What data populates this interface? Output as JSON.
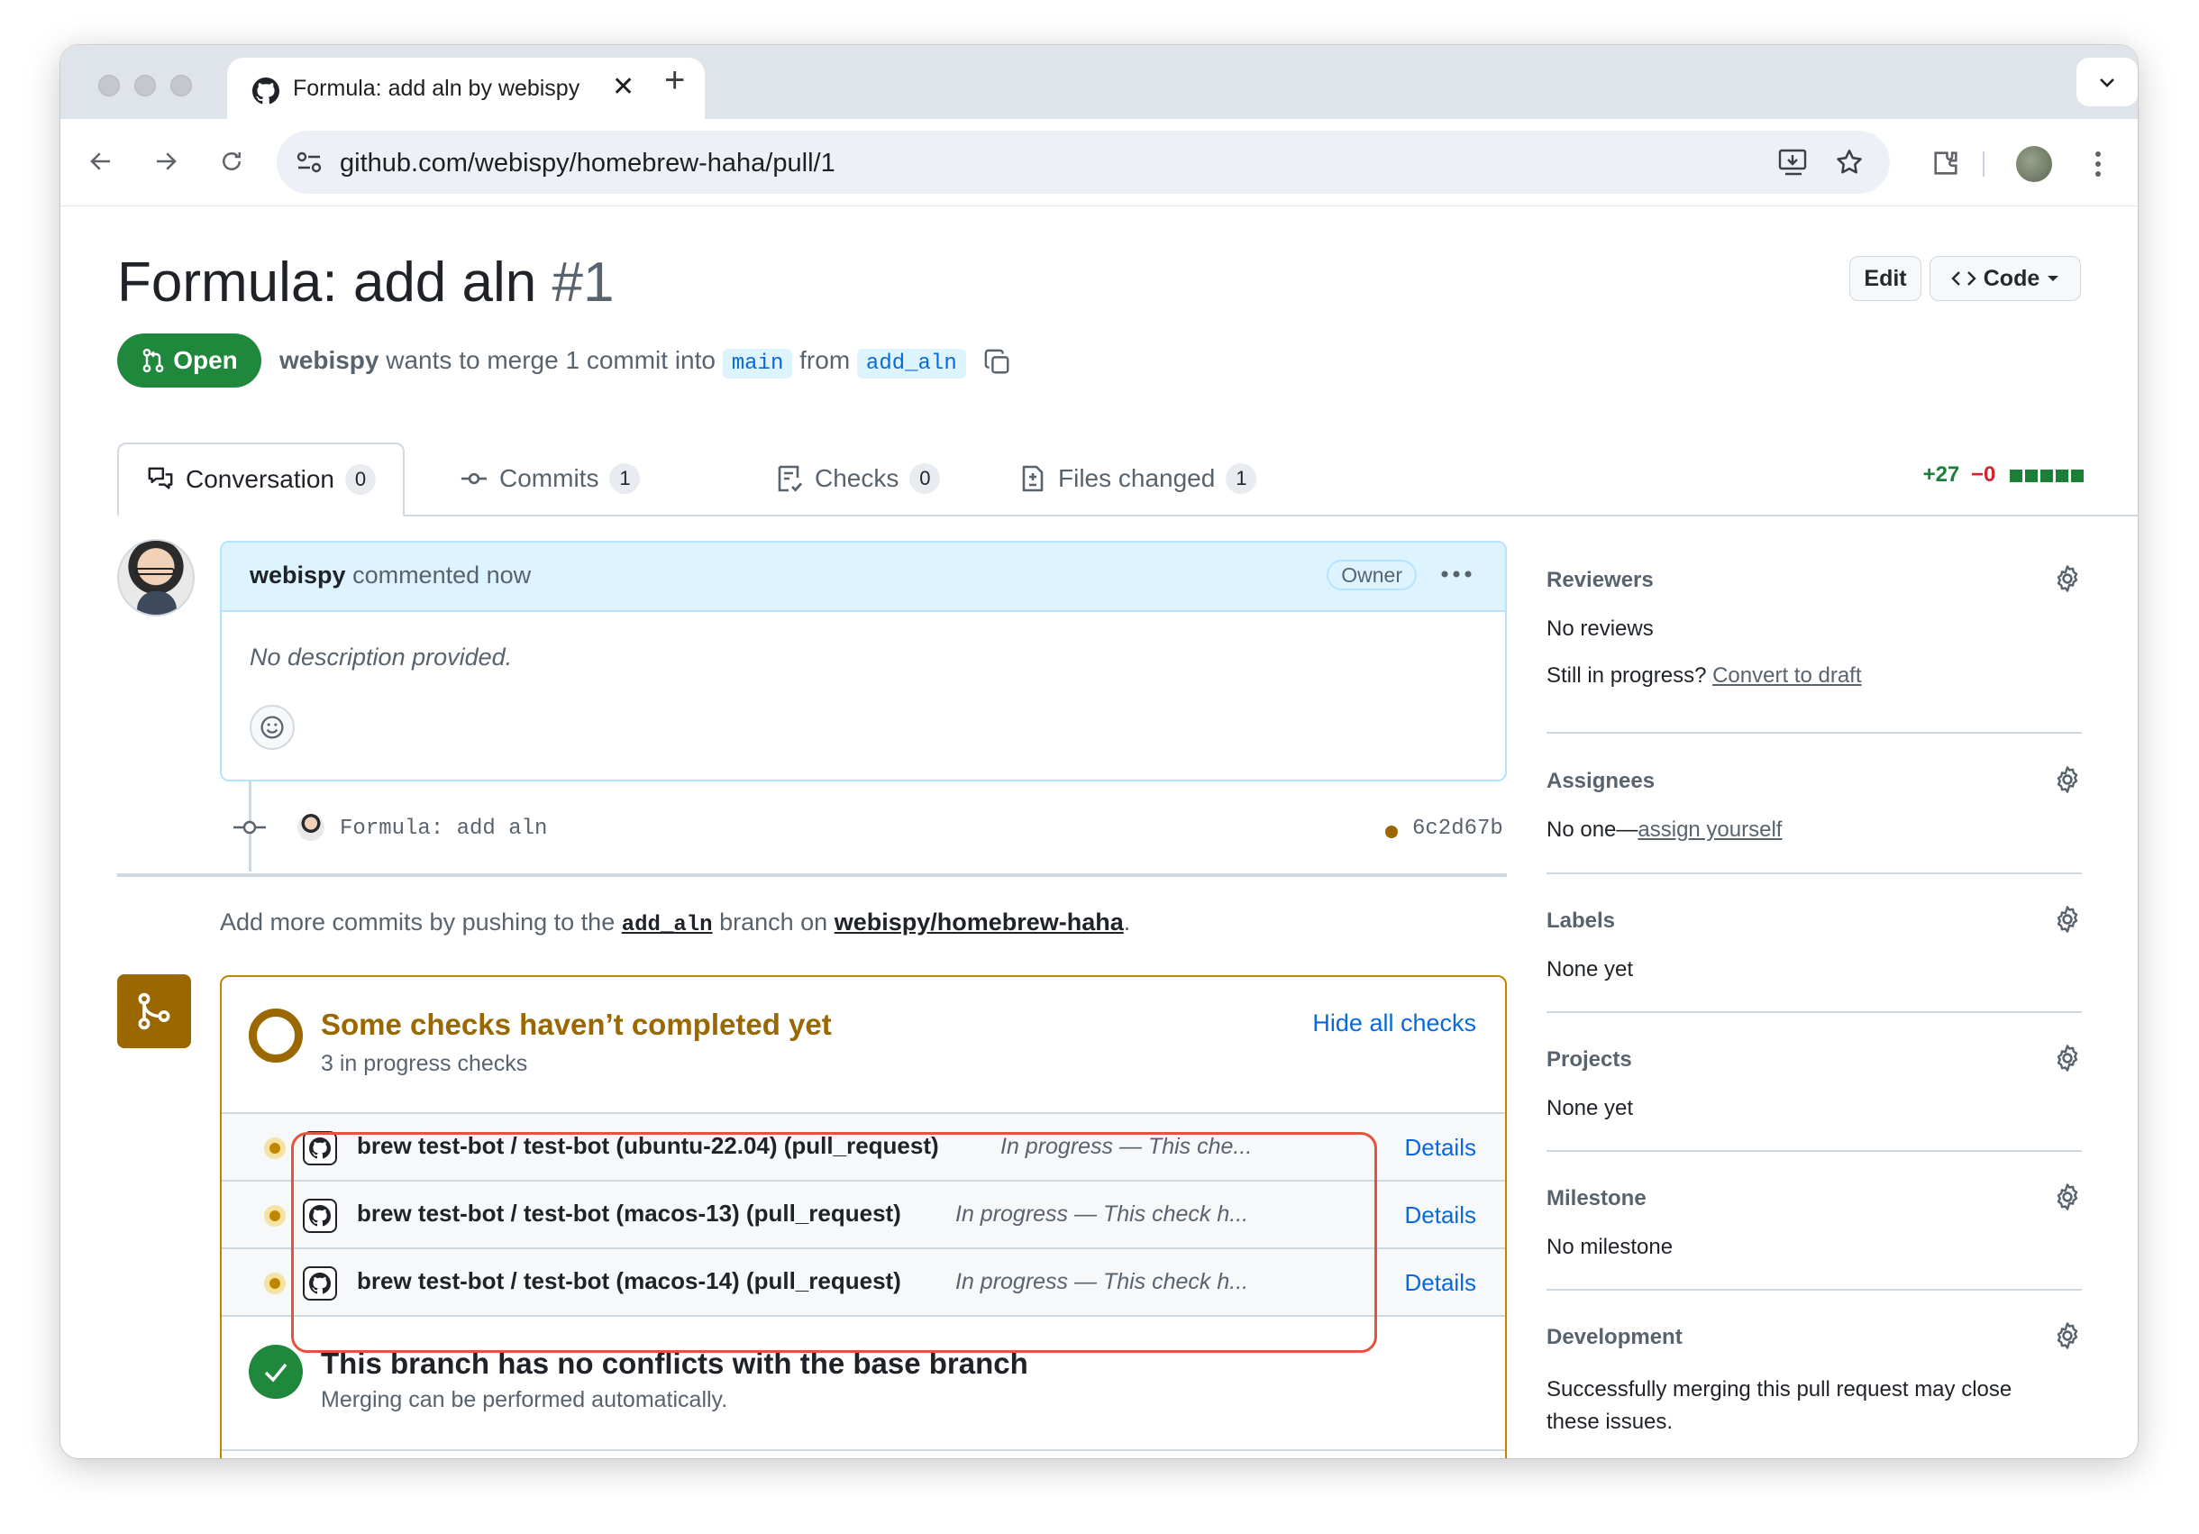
{
  "browser": {
    "tab_title": "Formula: add aln by webispy",
    "url": "github.com/webispy/homebrew-haha/pull/1"
  },
  "pr": {
    "title": "Formula: add aln",
    "number": "#1",
    "edit_label": "Edit",
    "code_label": "Code",
    "state": "Open",
    "author": "webispy",
    "merge_text": "wants to merge 1 commit into",
    "base_branch": "main",
    "from_text": "from",
    "head_branch": "add_aln"
  },
  "tabs": [
    {
      "label": "Conversation",
      "count": "0"
    },
    {
      "label": "Commits",
      "count": "1"
    },
    {
      "label": "Checks",
      "count": "0"
    },
    {
      "label": "Files changed",
      "count": "1"
    }
  ],
  "diffstat": {
    "added": "+27",
    "removed": "−0"
  },
  "comment": {
    "author": "webispy",
    "action": "commented now",
    "badge": "Owner",
    "body": "No description provided."
  },
  "commit": {
    "message": "Formula: add aln",
    "sha": "6c2d67b"
  },
  "push_hint": {
    "prefix": "Add more commits by pushing to the",
    "branch": "add_aln",
    "middle": "branch on",
    "repo": "webispy/homebrew-haha",
    "suffix": "."
  },
  "checks": {
    "title": "Some checks haven’t completed yet",
    "subtitle": "3 in progress checks",
    "hide_label": "Hide all checks",
    "rows": [
      {
        "name": "brew test-bot / test-bot (ubuntu-22.04) (pull_request)",
        "status": "In progress — This che...",
        "details": "Details"
      },
      {
        "name": "brew test-bot / test-bot (macos-13) (pull_request)",
        "status": "In progress — This check h...",
        "details": "Details"
      },
      {
        "name": "brew test-bot / test-bot (macos-14) (pull_request)",
        "status": "In progress — This check h...",
        "details": "Details"
      }
    ]
  },
  "merge_status": {
    "title": "This branch has no conflicts with the base branch",
    "subtitle": "Merging can be performed automatically."
  },
  "sidebar": {
    "reviewers": {
      "title": "Reviewers",
      "value": "No reviews",
      "draft_prefix": "Still in progress?",
      "draft_link": "Convert to draft"
    },
    "assignees": {
      "title": "Assignees",
      "value_prefix": "No one—",
      "value_link": "assign yourself"
    },
    "labels": {
      "title": "Labels",
      "value": "None yet"
    },
    "projects": {
      "title": "Projects",
      "value": "None yet"
    },
    "milestone": {
      "title": "Milestone",
      "value": "No milestone"
    },
    "development": {
      "title": "Development",
      "value": "Successfully merging this pull request may close these issues."
    }
  },
  "colors": {
    "open_green": "#1f883d",
    "link_blue": "#0969da",
    "pending_yellow": "#bf8700",
    "highlight_red": "#e5533d"
  }
}
